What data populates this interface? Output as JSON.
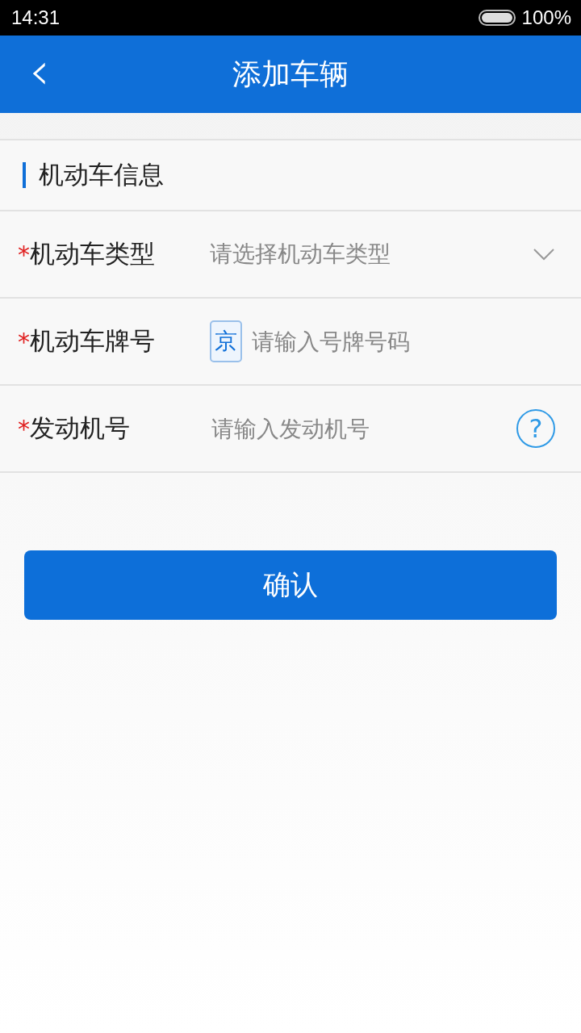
{
  "status_bar": {
    "time": "14:31",
    "battery": "100%"
  },
  "header": {
    "back": "‹",
    "title": "添加车辆"
  },
  "section": {
    "title": "机动车信息"
  },
  "fields": [
    {
      "kind": "select",
      "required_mark": "*",
      "label": "机动车类型",
      "placeholder": "请选择机动车类型"
    },
    {
      "kind": "plate",
      "required_mark": "*",
      "label": "机动车牌号",
      "prefix": "京",
      "placeholder": "请输入号牌号码"
    },
    {
      "kind": "help",
      "required_mark": "*",
      "label": "发动机号",
      "placeholder": "请输入发动机号",
      "help": "?"
    }
  ],
  "confirm_button": {
    "label": "确认"
  }
}
